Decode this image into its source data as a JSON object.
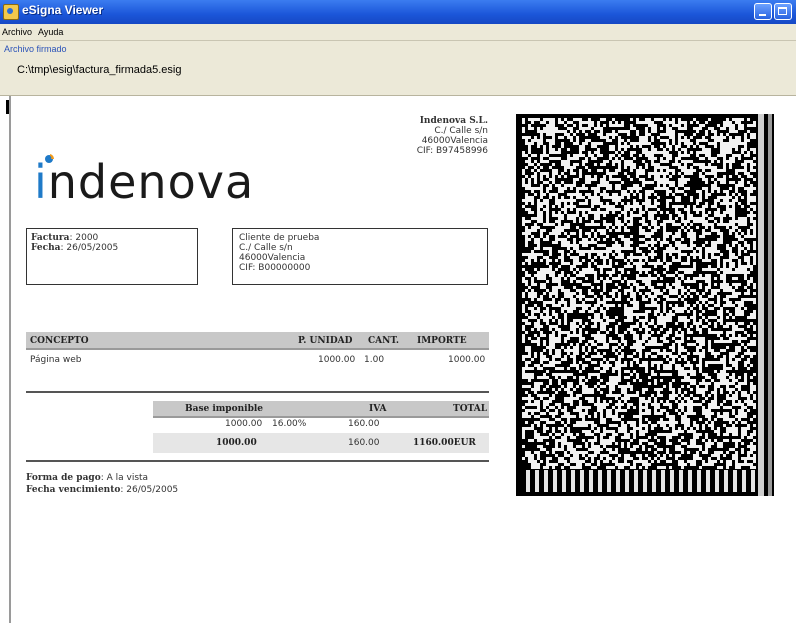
{
  "window": {
    "title": "eSigna Viewer"
  },
  "menu": {
    "archivo": "Archivo",
    "ayuda": "Ayuda"
  },
  "info": {
    "label": "Archivo firmado",
    "path": "C:\\tmp\\esig\\factura_firmada5.esig"
  },
  "company": {
    "name": "Indenova S.L.",
    "address": "C./ Calle s/n",
    "city": "46000Valencia",
    "cif": "CIF: B97458996"
  },
  "logo": {
    "text": "ndenova",
    "letter": "i",
    "brand_blue": "#1f7ac8",
    "brand_orange": "#f29a1a"
  },
  "invoice": {
    "factura_label": "Factura",
    "factura_value": ": 2000",
    "fecha_label": "Fecha",
    "fecha_value": ": 26/05/2005"
  },
  "client": {
    "name": "Cliente de prueba",
    "address": "C./ Calle s/n",
    "city": "46000Valencia",
    "cif": "CIF: B00000000"
  },
  "table": {
    "headers": [
      "CONCEPTO",
      "P. UNIDAD",
      "CANT.",
      "IMPORTE"
    ],
    "rows": [
      {
        "concepto": "Página web",
        "unidad": "1000.00",
        "cant": "1.00",
        "importe": "1000.00"
      }
    ]
  },
  "summary": {
    "headers": {
      "base": "Base imponible",
      "iva": "IVA",
      "total": "TOTAL"
    },
    "row1": {
      "base": "1000.00",
      "pct": "16.00%",
      "iva": "160.00"
    },
    "row2": {
      "base": "1000.00",
      "iva": "160.00",
      "total": "1160.00EUR"
    }
  },
  "payment": {
    "forma_label": "Forma de pago",
    "forma_value": ": A la vista",
    "venc_label": "Fecha vencimiento",
    "venc_value": ": 26/05/2005"
  }
}
